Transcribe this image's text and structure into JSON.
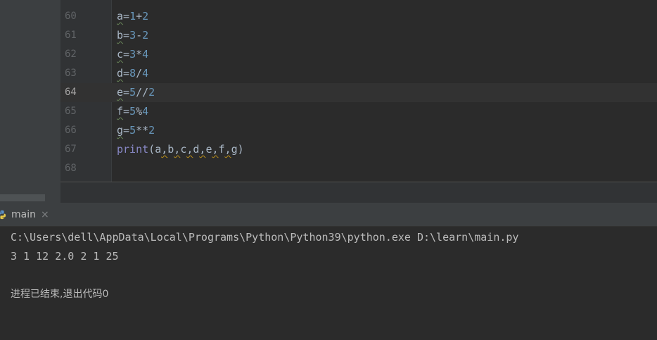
{
  "editor": {
    "lines": [
      {
        "no": "60",
        "var": "a",
        "rest": [
          [
            "=",
            ""
          ],
          [
            "1",
            "num"
          ],
          [
            "+",
            ""
          ],
          [
            "2",
            "num"
          ]
        ]
      },
      {
        "no": "61",
        "var": "b",
        "rest": [
          [
            "=",
            ""
          ],
          [
            "3",
            "num"
          ],
          [
            "-",
            ""
          ],
          [
            "2",
            "num"
          ]
        ]
      },
      {
        "no": "62",
        "var": "c",
        "rest": [
          [
            "=",
            ""
          ],
          [
            "3",
            "num"
          ],
          [
            "*",
            ""
          ],
          [
            "4",
            "num"
          ]
        ]
      },
      {
        "no": "63",
        "var": "d",
        "rest": [
          [
            "=",
            ""
          ],
          [
            "8",
            "num"
          ],
          [
            "/",
            ""
          ],
          [
            "4",
            "num"
          ]
        ]
      },
      {
        "no": "64",
        "var": "e",
        "rest": [
          [
            "=",
            ""
          ],
          [
            "5",
            "num"
          ],
          [
            "//",
            ""
          ],
          [
            "2",
            "num"
          ]
        ]
      },
      {
        "no": "65",
        "var": "f",
        "rest": [
          [
            "=",
            ""
          ],
          [
            "5",
            "num"
          ],
          [
            "%",
            ""
          ],
          [
            "4",
            "num"
          ]
        ]
      },
      {
        "no": "66",
        "var": "g",
        "rest": [
          [
            "=",
            ""
          ],
          [
            "5",
            "num"
          ],
          [
            "**",
            ""
          ],
          [
            "2",
            "num"
          ]
        ]
      }
    ],
    "print_line": {
      "no": "67",
      "fn": "print",
      "open": "(",
      "args": [
        "a",
        "b",
        "c",
        "d",
        "e",
        "f",
        "g"
      ],
      "sep": ",",
      "close": ")"
    },
    "empty_line": {
      "no": "68"
    },
    "current_line": "64"
  },
  "run_panel": {
    "tab_label": "main",
    "close_glyph": "×",
    "icon": "python-icon"
  },
  "console": {
    "command": "C:\\Users\\dell\\AppData\\Local\\Programs\\Python\\Python39\\python.exe D:\\learn\\main.py",
    "output": "3 1 12 2.0 2 1 25",
    "exit_message": "进程已结束,退出代码0"
  },
  "colors": {
    "background": "#2b2b2b",
    "number": "#6897bb",
    "builtin": "#8888c6",
    "text": "#a9b7c6"
  }
}
